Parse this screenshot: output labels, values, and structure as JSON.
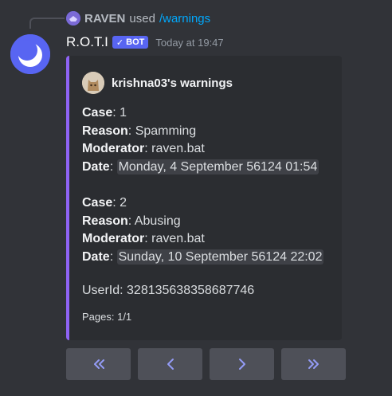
{
  "reply": {
    "user": "RAVEN",
    "used_text": "used",
    "command": "/warnings"
  },
  "message": {
    "username": "R.O.T.I",
    "bot_tag": "BOT",
    "timestamp": "Today at 19:47"
  },
  "embed": {
    "accent_color": "#8e63f4",
    "author": "krishna03's warnings",
    "cases": [
      {
        "case_label": "Case",
        "case_value": ": 1",
        "reason_label": "Reason",
        "reason_value": ": Spamming",
        "moderator_label": "Moderator",
        "moderator_value": ": raven.bat",
        "date_label": "Date",
        "date_value": "Monday, 4 September 56124 01:54"
      },
      {
        "case_label": "Case",
        "case_value": ": 2",
        "reason_label": "Reason",
        "reason_value": ": Abusing",
        "moderator_label": "Moderator",
        "moderator_value": ": raven.bat",
        "date_label": "Date",
        "date_value": "Sunday, 10 September 56124 22:02"
      }
    ],
    "user_id": "UserId: 328135638358687746",
    "footer": "Pages: 1/1"
  },
  "buttons": [
    {
      "icon": "double-chevron-left-icon",
      "glyph": "«"
    },
    {
      "icon": "chevron-left-icon",
      "glyph": "‹"
    },
    {
      "icon": "chevron-right-icon",
      "glyph": "›"
    },
    {
      "icon": "double-chevron-right-icon",
      "glyph": "»"
    }
  ]
}
